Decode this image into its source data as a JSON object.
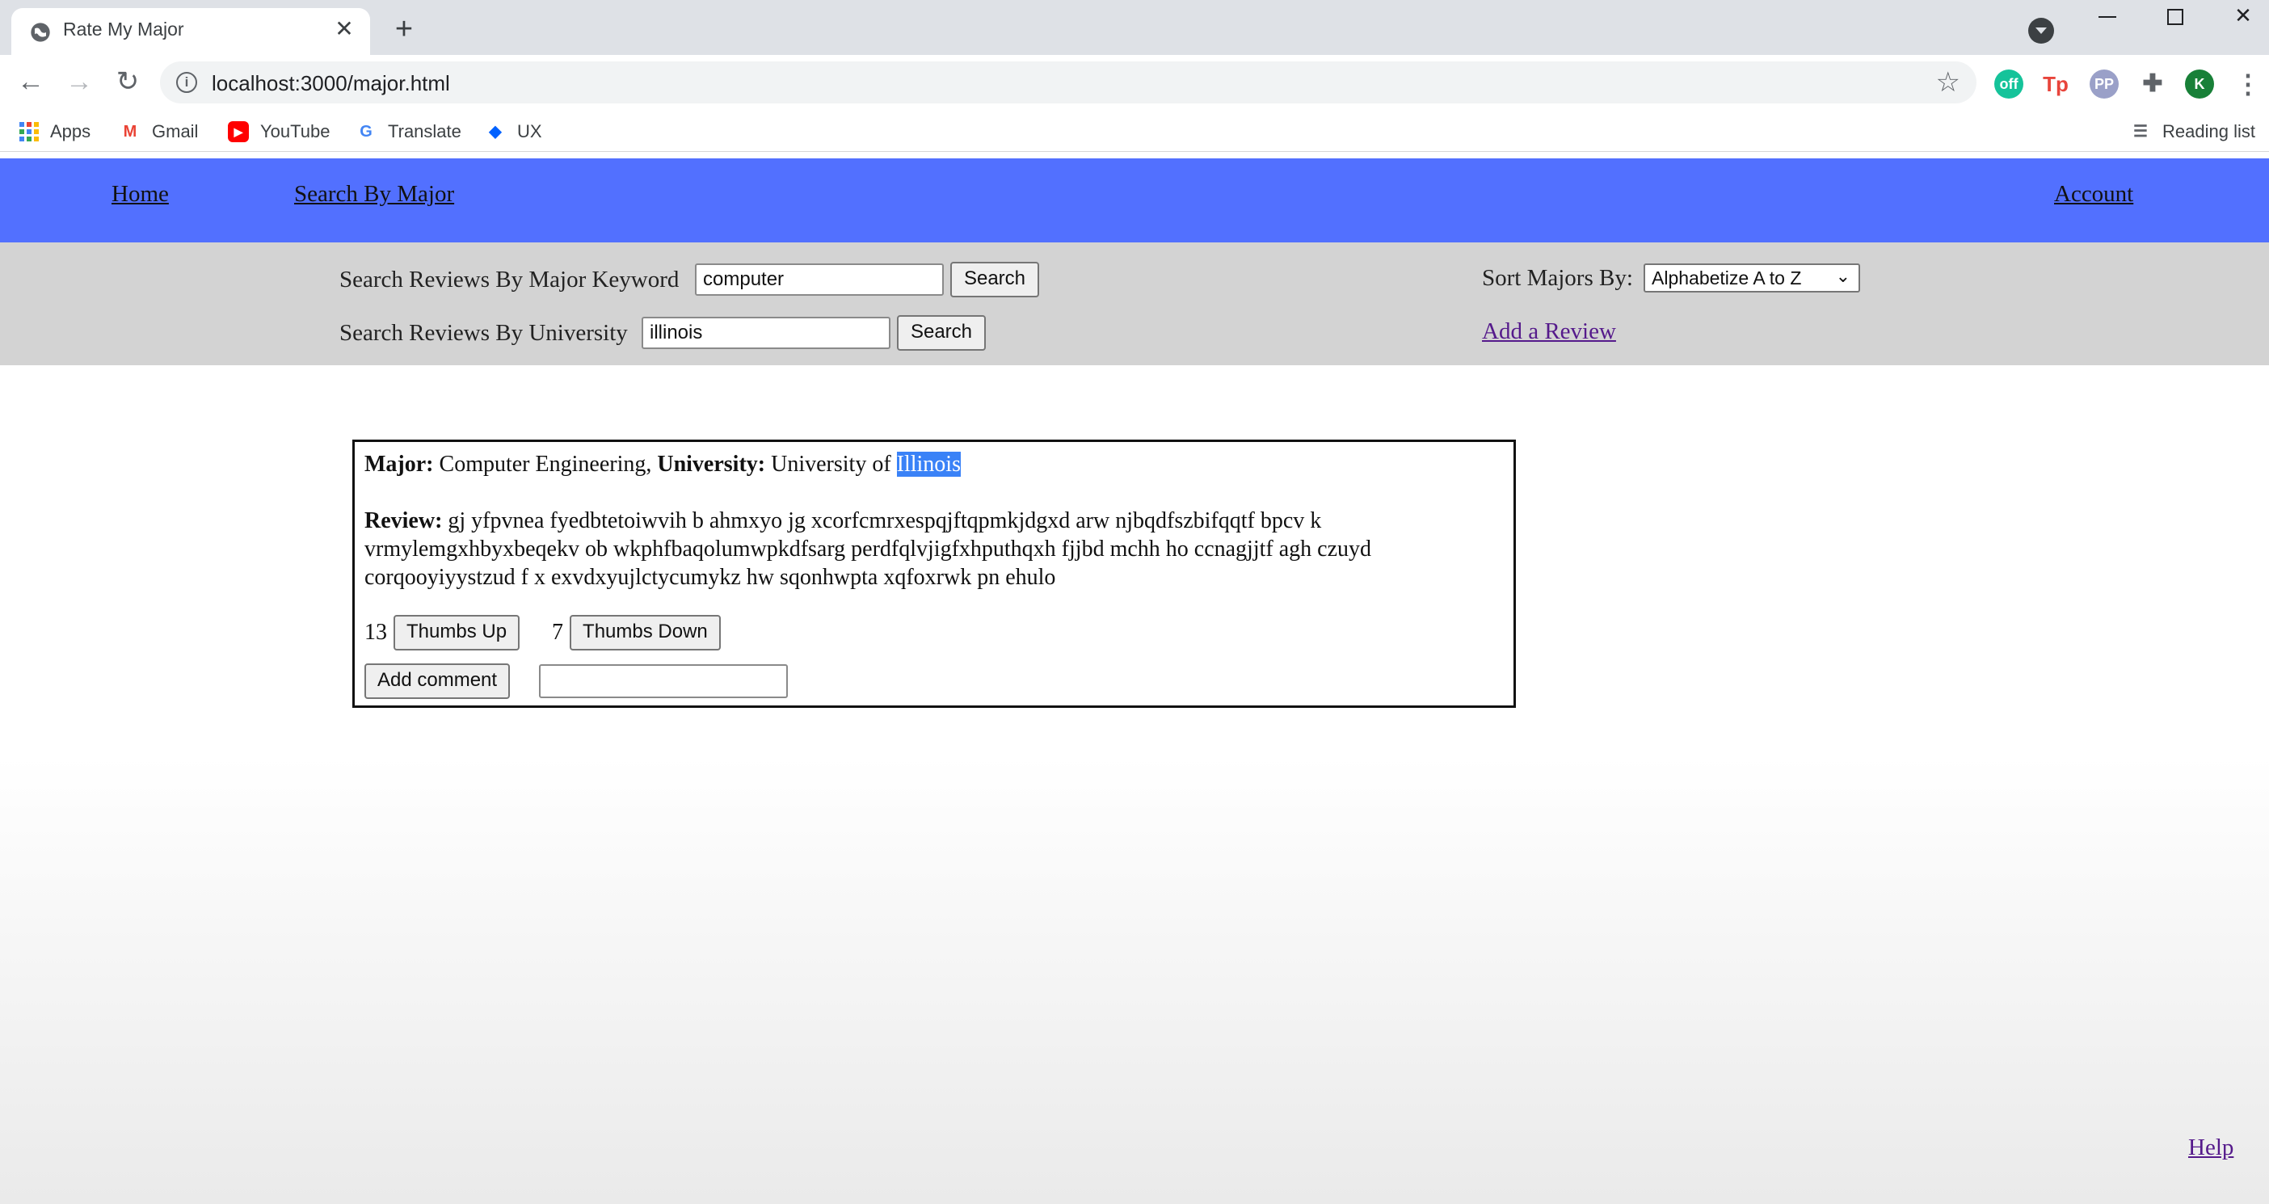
{
  "browser": {
    "tab_title": "Rate My Major",
    "url": "localhost:3000/major.html",
    "bookmarks": [
      {
        "label": "Apps"
      },
      {
        "label": "Gmail"
      },
      {
        "label": "YouTube"
      },
      {
        "label": "Translate"
      },
      {
        "label": "UX"
      }
    ],
    "reading_list": "Reading list",
    "profile_initial": "K",
    "extension_grammarly_badge": "off",
    "extension_tp": "Tp",
    "extension_pp": "PP"
  },
  "nav": {
    "home": "Home",
    "search_by_major": "Search By Major",
    "account": "Account"
  },
  "search": {
    "keyword_label": "Search Reviews By Major Keyword",
    "keyword_value": "computer",
    "keyword_button": "Search",
    "university_label": "Search Reviews By University",
    "university_value": "illinois",
    "university_button": "Search",
    "sort_label": "Sort Majors By:",
    "sort_selected": "Alphabetize A to Z",
    "add_review": "Add a Review"
  },
  "review": {
    "major_label": "Major:",
    "major_value": "Computer Engineering,",
    "university_label": "University:",
    "university_value_prefix": "University of",
    "university_value_highlight": "Illinois",
    "review_label": "Review:",
    "review_text": "gj yfpvnea fyedbtetoiwvih b ahmxyo jg xcorfcmrxespqjftqpmkjdgxd arw njbqdfszbifqqtf bpcv k vrmylemgxhbyxbeqekv ob wkphfbaqolumwpkdfsarg perdfqlvjigfxhputhqxh fjjbd mchh ho ccnagjjtf agh czuyd corqooyiyystzud f x exvdxyujlctycumykz hw sqonhwpta xqfoxrwk pn ehulo",
    "thumbs_up_count": "13",
    "thumbs_up_label": "Thumbs Up",
    "thumbs_down_count": "7",
    "thumbs_down_label": "Thumbs Down",
    "add_comment_label": "Add comment",
    "comment_value": ""
  },
  "footer": {
    "help": "Help"
  },
  "colors": {
    "nav_bg": "#5270ff",
    "panel_bg": "#d3d3d3",
    "highlight": "#3a82f7",
    "visited_link": "#551a8b"
  }
}
